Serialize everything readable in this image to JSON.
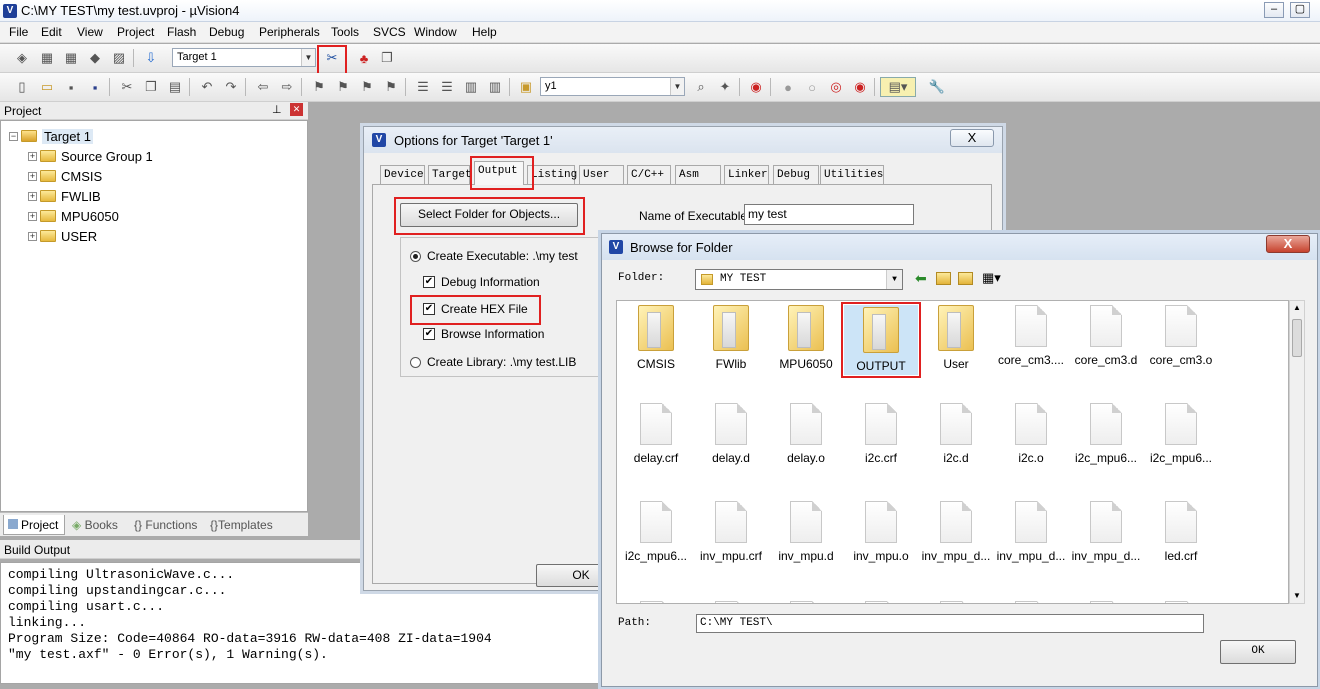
{
  "window": {
    "title": "C:\\MY TEST\\my test.uvproj - µVision4",
    "icon": "V"
  },
  "menu": [
    "File",
    "Edit",
    "View",
    "Project",
    "Flash",
    "Debug",
    "Peripherals",
    "Tools",
    "SVCS",
    "Window",
    "Help"
  ],
  "toolbar": {
    "target_select": "Target 1",
    "find_combo": "y1"
  },
  "project_panel": {
    "header": "Project",
    "root": "Target 1",
    "groups": [
      "Source Group 1",
      "CMSIS",
      "FWLIB",
      "MPU6050",
      "USER"
    ],
    "tabs": [
      "Project",
      "Books",
      "Functions",
      "Templates"
    ],
    "tab_prefixes": [
      "",
      "",
      "{}",
      "{}"
    ]
  },
  "build_output": {
    "header": "Build Output",
    "lines": [
      "compiling UltrasonicWave.c...",
      "compiling upstandingcar.c...",
      "compiling usart.c...",
      "linking...",
      "Program Size: Code=40864 RO-data=3916 RW-data=408 ZI-data=1904",
      "\"my test.axf\" - 0 Error(s), 1 Warning(s)."
    ]
  },
  "options_dialog": {
    "title": "Options for Target 'Target 1'",
    "close": "X",
    "tabs": [
      "Device",
      "Target",
      "Output",
      "Listing",
      "User",
      "C/C++",
      "Asm",
      "Linker",
      "Debug",
      "Utilities"
    ],
    "select_folder_button": "Select Folder for Objects...",
    "name_label": "Name of Executable:",
    "name_value": "my test",
    "create_executable": "Create Executable:  .\\my test",
    "debug_info": "Debug Information",
    "create_hex": "Create HEX File",
    "browse_info": "Browse Information",
    "create_library": "Create Library:  .\\my test.LIB",
    "ok": "OK"
  },
  "browse_dialog": {
    "title": "Browse for Folder",
    "close": "X",
    "folder_label": "Folder:",
    "folder_value": "MY TEST",
    "path_label": "Path:",
    "path_value": "C:\\MY TEST\\",
    "ok": "OK",
    "items": [
      {
        "name": "CMSIS",
        "type": "folder"
      },
      {
        "name": "FWlib",
        "type": "folder"
      },
      {
        "name": "MPU6050",
        "type": "folder"
      },
      {
        "name": "OUTPUT",
        "type": "folder",
        "selected": true
      },
      {
        "name": "User",
        "type": "folder"
      },
      {
        "name": "core_cm3....",
        "type": "file"
      },
      {
        "name": "core_cm3.d",
        "type": "file"
      },
      {
        "name": "core_cm3.o",
        "type": "file"
      },
      {
        "name": "delay.crf",
        "type": "file"
      },
      {
        "name": "delay.d",
        "type": "file"
      },
      {
        "name": "delay.o",
        "type": "file"
      },
      {
        "name": "i2c.crf",
        "type": "file"
      },
      {
        "name": "i2c.d",
        "type": "file"
      },
      {
        "name": "i2c.o",
        "type": "file"
      },
      {
        "name": "i2c_mpu6...",
        "type": "file"
      },
      {
        "name": "i2c_mpu6...",
        "type": "file"
      },
      {
        "name": "i2c_mpu6...",
        "type": "file"
      },
      {
        "name": "inv_mpu.crf",
        "type": "file"
      },
      {
        "name": "inv_mpu.d",
        "type": "file"
      },
      {
        "name": "inv_mpu.o",
        "type": "file"
      },
      {
        "name": "inv_mpu_d...",
        "type": "file"
      },
      {
        "name": "inv_mpu_d...",
        "type": "file"
      },
      {
        "name": "inv_mpu_d...",
        "type": "file"
      },
      {
        "name": "led.crf",
        "type": "file"
      }
    ]
  },
  "colors": {
    "highlight": "#e02020",
    "selection": "#cce4f7"
  }
}
